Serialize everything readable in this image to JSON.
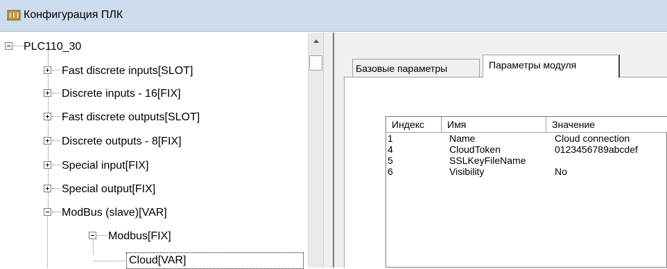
{
  "window": {
    "title": "Конфигурация ПЛК",
    "icon": "plc-config-icon"
  },
  "tree": {
    "root": {
      "label": "PLC110_30",
      "expanded": true
    },
    "items": [
      {
        "label": "Fast discrete inputs[SLOT]",
        "expanded": false
      },
      {
        "label": "Discrete inputs - 16[FIX]",
        "expanded": false
      },
      {
        "label": "Fast discrete outputs[SLOT]",
        "expanded": false
      },
      {
        "label": "Discrete outputs - 8[FIX]",
        "expanded": false
      },
      {
        "label": "Special input[FIX]",
        "expanded": false
      },
      {
        "label": "Special output[FIX]",
        "expanded": false
      },
      {
        "label": "ModBus (slave)[VAR]",
        "expanded": true
      }
    ],
    "sub_item": {
      "label": "Modbus[FIX]",
      "expanded": true
    },
    "leaf_item": {
      "label": "Cloud[VAR]",
      "selected": true
    }
  },
  "tabs": {
    "base": "Базовые параметры",
    "module": "Параметры модуля",
    "active": "module"
  },
  "grid": {
    "headers": [
      "Индекс",
      "Имя",
      "Значение"
    ],
    "rows": [
      {
        "index": "1",
        "name": "Name",
        "value": "Cloud connection"
      },
      {
        "index": "4",
        "name": "CloudToken",
        "value": "0123456789abcdef"
      },
      {
        "index": "5",
        "name": "SSLKeyFileName",
        "value": ""
      },
      {
        "index": "6",
        "name": "Visibility",
        "value": "No"
      }
    ]
  },
  "colors": {
    "titlebar": "#cfdcee",
    "pane_bg": "#f0f0f0"
  }
}
